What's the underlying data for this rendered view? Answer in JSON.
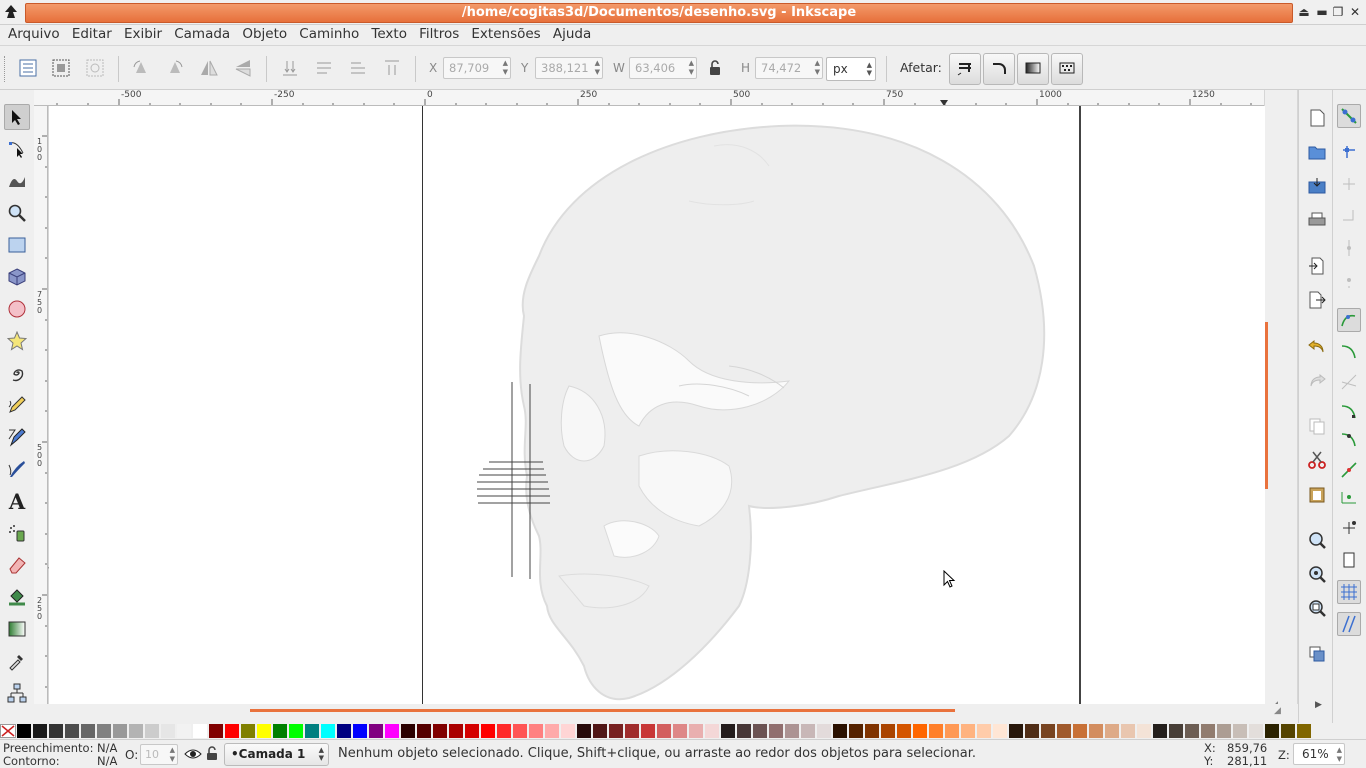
{
  "window": {
    "title": "/home/cogitas3d/Documentos/desenho.svg - Inkscape",
    "buttons": [
      "eject-icon",
      "minimize-icon",
      "restore-icon",
      "close-icon"
    ]
  },
  "menu": [
    "Arquivo",
    "Editar",
    "Exibir",
    "Camada",
    "Objeto",
    "Caminho",
    "Texto",
    "Filtros",
    "Extensões",
    "Ajuda"
  ],
  "controls": {
    "x_label": "X",
    "x_value": "87,709",
    "y_label": "Y",
    "y_value": "388,121",
    "w_label": "W",
    "w_value": "63,406",
    "h_label": "H",
    "h_value": "74,472",
    "unit": "px",
    "affect_label": "Afetar:"
  },
  "ruler_top": [
    "-500",
    "-250",
    "0",
    "250",
    "500",
    "750",
    "1000",
    "1250"
  ],
  "ruler_left": [
    "1\n0\n0",
    "7\n5\n0",
    "5\n0\n0",
    "2\n5\n0"
  ],
  "tools": [
    "selector-icon",
    "node-icon",
    "tweak-icon",
    "zoom-icon",
    "rect-icon",
    "3dbox-icon",
    "ellipse-icon",
    "star-icon",
    "spiral-icon",
    "pencil-icon",
    "pen-icon",
    "calligraphy-icon",
    "text-icon",
    "spray-icon",
    "eraser-icon",
    "paint-bucket-icon",
    "gradient-icon",
    "dropper-icon",
    "connector-icon"
  ],
  "palette_colors": [
    "#000000",
    "#1a1a1a",
    "#333333",
    "#4d4d4d",
    "#666666",
    "#808080",
    "#999999",
    "#b3b3b3",
    "#cccccc",
    "#e6e6e6",
    "#f2f2f2",
    "#ffffff",
    "#800000",
    "#ff0000",
    "#808000",
    "#ffff00",
    "#008000",
    "#00ff00",
    "#008080",
    "#00ffff",
    "#000080",
    "#0000ff",
    "#800080",
    "#ff00ff",
    "#2b0000",
    "#550000",
    "#800000",
    "#aa0000",
    "#d40000",
    "#ff0000",
    "#ff2a2a",
    "#ff5555",
    "#ff8080",
    "#ffaaaa",
    "#ffd5d5",
    "#280b0b",
    "#501616",
    "#782121",
    "#a02c2c",
    "#c83737",
    "#d35f5f",
    "#de8787",
    "#e9afaf",
    "#f4d7d7",
    "#241c1c",
    "#483737",
    "#6c5353",
    "#916f6f",
    "#ac9393",
    "#c8b7b7",
    "#e3dbdb",
    "#2b1100",
    "#552200",
    "#803300",
    "#aa4400",
    "#d45500",
    "#ff6600",
    "#ff7f2a",
    "#ff9955",
    "#ffb380",
    "#ffccaa",
    "#ffe6d5",
    "#28170b",
    "#502d16",
    "#784421",
    "#a05a2c",
    "#c87137",
    "#d38d5f",
    "#deaa87",
    "#e9c6af",
    "#f4e3d7",
    "#241f1c",
    "#483e37",
    "#6c5d53",
    "#917c6f",
    "#ac9d93",
    "#c8beb7",
    "#e3dedb",
    "#2b2200",
    "#554400",
    "#806600"
  ],
  "status": {
    "fill_label": "Preenchimento:",
    "fill_value": "N/A",
    "stroke_label": "Contorno:",
    "stroke_value": "N/A",
    "opacity_label": "O:",
    "opacity_value": "10",
    "layer": "•Camada 1",
    "message": "Nenhum objeto selecionado. Clique, Shift+clique, ou arraste ao redor dos objetos para selecionar.",
    "x_label": "X:",
    "x_value": "859,76",
    "y_label": "Y:",
    "y_value": "281,11",
    "zoom_label": "Z:",
    "zoom_value": "61%"
  }
}
